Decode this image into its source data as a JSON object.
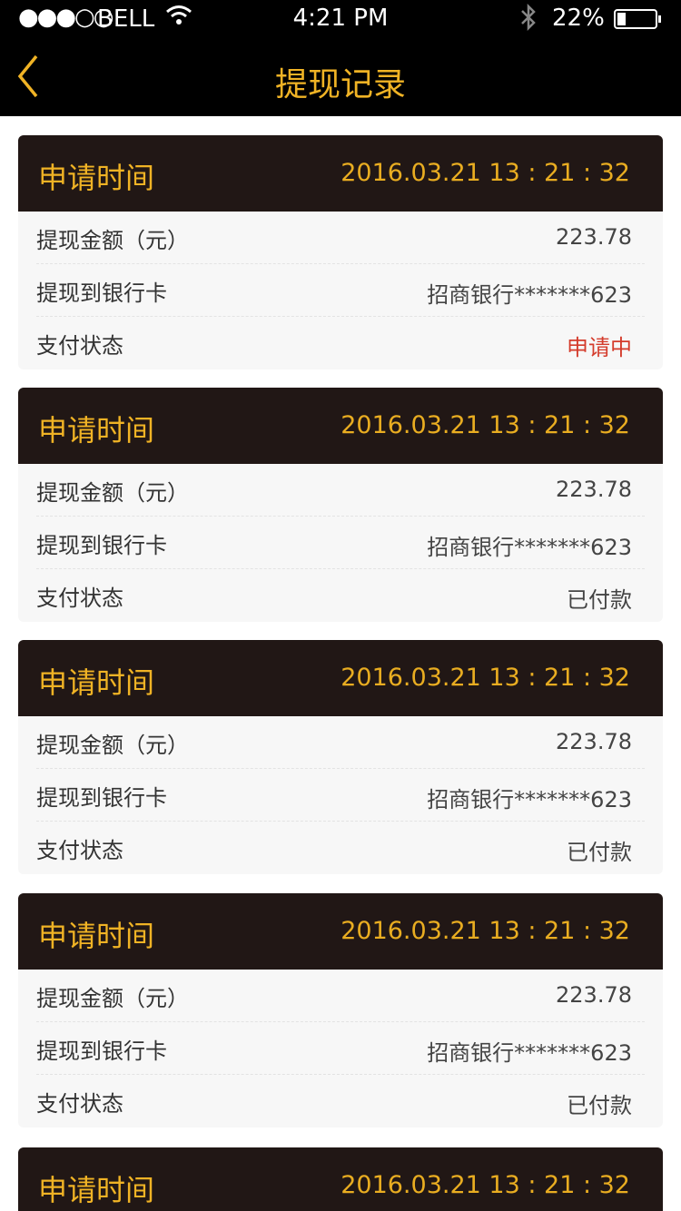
{
  "status_bar": {
    "signal": "●●●○○",
    "carrier": "BELL",
    "time": "4:21 PM",
    "battery_percent": "22%",
    "battery_level": 0.22
  },
  "nav": {
    "title": "提现记录",
    "back_icon": "chevron-left-icon"
  },
  "colors": {
    "accent": "#f0b325",
    "header_bg": "#211715",
    "pending": "#d43c2c"
  },
  "records": [
    {
      "head_label": "申请时间",
      "datetime": "2016.03.21 13 : 21 : 32",
      "amount_label": "提现金额（元）",
      "amount": "223.78",
      "card_label": "提现到银行卡",
      "card": "招商银行*******623",
      "status_label": "支付状态",
      "status": "申请中",
      "status_kind": "pending"
    },
    {
      "head_label": "申请时间",
      "datetime": "2016.03.21 13 : 21 : 32",
      "amount_label": "提现金额（元）",
      "amount": "223.78",
      "card_label": "提现到银行卡",
      "card": "招商银行*******623",
      "status_label": "支付状态",
      "status": "已付款",
      "status_kind": "paid"
    },
    {
      "head_label": "申请时间",
      "datetime": "2016.03.21 13 : 21 : 32",
      "amount_label": "提现金额（元）",
      "amount": "223.78",
      "card_label": "提现到银行卡",
      "card": "招商银行*******623",
      "status_label": "支付状态",
      "status": "已付款",
      "status_kind": "paid"
    },
    {
      "head_label": "申请时间",
      "datetime": "2016.03.21 13 : 21 : 32",
      "amount_label": "提现金额（元）",
      "amount": "223.78",
      "card_label": "提现到银行卡",
      "card": "招商银行*******623",
      "status_label": "支付状态",
      "status": "已付款",
      "status_kind": "paid"
    },
    {
      "head_label": "申请时间",
      "datetime": "2016.03.21 13 : 21 : 32"
    }
  ]
}
